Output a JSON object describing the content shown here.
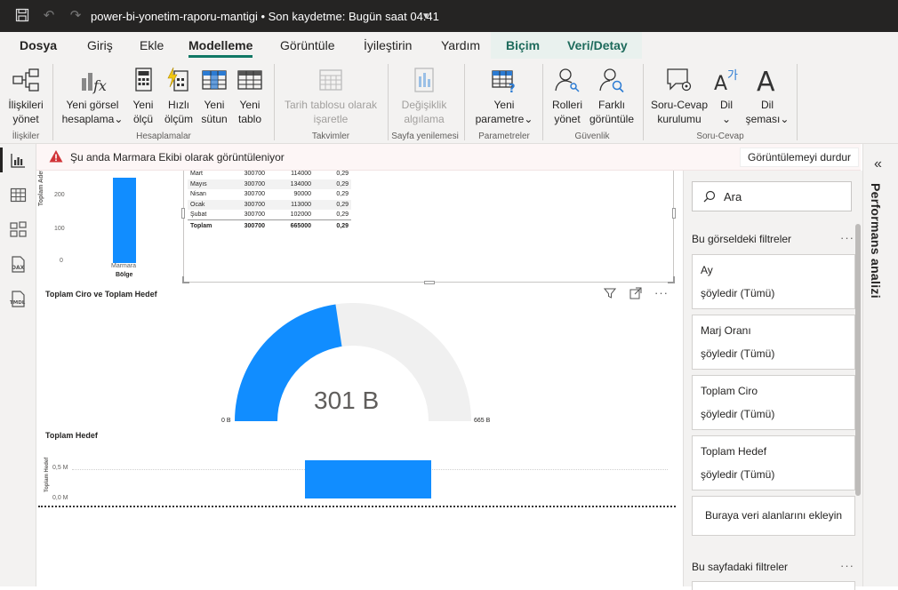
{
  "titlebar": {
    "title": "power-bi-yonetim-raporu-mantigi • Son kaydetme: Bugün saat 04:41"
  },
  "menu": {
    "tabs": [
      "Dosya",
      "Giriş",
      "Ekle",
      "Modelleme",
      "Görüntüle",
      "İyileştirin",
      "Yardım",
      "Biçim",
      "Veri/Detay"
    ],
    "active": "Modelleme"
  },
  "ribbon": {
    "manage_relationships": [
      "İlişkileri",
      "yönet"
    ],
    "new_visual_calc": [
      "Yeni görsel",
      "hesaplama"
    ],
    "new_measure": [
      "Yeni",
      "ölçü"
    ],
    "quick_measure": [
      "Hızlı",
      "ölçüm"
    ],
    "new_column": [
      "Yeni",
      "sütun"
    ],
    "new_table": [
      "Yeni",
      "tablo"
    ],
    "mark_date_table": [
      "Tarih tablosu olarak",
      "işaretle"
    ],
    "change_detection": [
      "Değişiklik",
      "algılama"
    ],
    "new_parameter": [
      "Yeni",
      "parametre"
    ],
    "manage_roles": [
      "Rolleri",
      "yönet"
    ],
    "view_as": [
      "Farklı",
      "görüntüle"
    ],
    "qa_setup": [
      "Soru-Cevap",
      "kurulumu"
    ],
    "language": [
      "Dil"
    ],
    "linguistic_schema": [
      "Dil",
      "şeması"
    ],
    "groups": [
      "İlişkiler",
      "Hesaplamalar",
      "Takvimler",
      "Sayfa yenilemesi",
      "Parametreler",
      "Güvenlik",
      "Soru-Cevap"
    ]
  },
  "banner": {
    "message": "Şu anda Marmara Ekibi olarak görüntüleniyor",
    "stop_button": "Görüntülemeyi durdur"
  },
  "bar_chart": {
    "ylabel": "Toplam Adet",
    "xlabel": "Bölge",
    "ticks": [
      "200",
      "100",
      "0"
    ],
    "category": "Marmara"
  },
  "table": {
    "rows": [
      [
        "Mart",
        "300700",
        "114000",
        "0,29"
      ],
      [
        "Mayıs",
        "300700",
        "134000",
        "0,29"
      ],
      [
        "Nisan",
        "300700",
        "90000",
        "0,29"
      ],
      [
        "Ocak",
        "300700",
        "113000",
        "0,29"
      ],
      [
        "Şubat",
        "300700",
        "102000",
        "0,29"
      ]
    ],
    "total": [
      "Toplam",
      "300700",
      "665000",
      "0,29"
    ]
  },
  "gauge": {
    "title": "Toplam Ciro ve Toplam Hedef",
    "value_label": "301 B",
    "min_label": "0 B",
    "max_label": "665 B",
    "fraction": 0.453
  },
  "hbar": {
    "title": "Toplam Hedef",
    "ylabel": "Toplam Hedef",
    "ticks": [
      "0,5 M",
      "0,0 M"
    ]
  },
  "filters": {
    "search_placeholder": "Ara",
    "visual_section": "Bu görseldeki filtreler",
    "cards": [
      {
        "name": "Ay",
        "value": "şöyledir (Tümü)"
      },
      {
        "name": "Marj Oranı",
        "value": "şöyledir (Tümü)"
      },
      {
        "name": "Toplam Ciro",
        "value": "şöyledir (Tümü)"
      },
      {
        "name": "Toplam Hedef",
        "value": "şöyledir (Tümü)"
      }
    ],
    "add_fields": "Buraya veri alanlarını ekleyin",
    "page_section": "Bu sayfadaki filtreler"
  },
  "perf_pane": {
    "title": "Performans analizi"
  },
  "colors": {
    "accent": "#118dff",
    "ribbon_bg": "#f3f2f1",
    "active_underline": "#117865"
  }
}
